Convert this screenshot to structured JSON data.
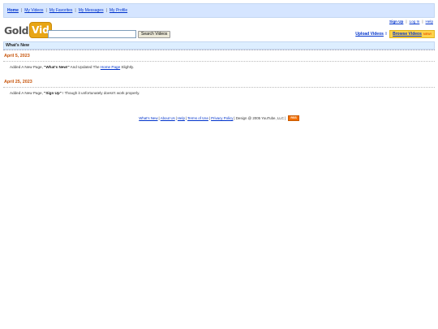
{
  "topnav": {
    "items": [
      {
        "label": "Home"
      },
      {
        "label": "My Videos"
      },
      {
        "label": "My Favorites"
      },
      {
        "label": "My Messages"
      },
      {
        "label": "My Profile"
      }
    ],
    "separator": "|"
  },
  "userlinks": {
    "sign_up": "Sign Up",
    "log_in": "Log In",
    "help": "Help",
    "separator": "|"
  },
  "logo": {
    "part1": "Gold",
    "part2": "Vid"
  },
  "search": {
    "value": "",
    "button_label": "Search Videos"
  },
  "actions": {
    "upload_label": "Upload Videos",
    "upload_icon": "arrow-up",
    "browse_label": "Browse Videos",
    "browse_badge": "NEW!"
  },
  "section": {
    "title": "What's New"
  },
  "entries": [
    {
      "date": "April 5, 2023",
      "prefix": "Added A New Page, ",
      "page_name": "\"What's New!\"",
      "middle": " And Updated The ",
      "link": "Home Page",
      "suffix": " Slightly."
    },
    {
      "date": "April 25, 2023",
      "prefix": "Added A New Page, ",
      "page_name": "\"Sign Up\"",
      "suffix": " ! Though it unfortunately doesn't work properly."
    }
  ],
  "footer": {
    "links": [
      "What's New",
      "About Us",
      "Help",
      "Terms of Use",
      "Privacy Policy"
    ],
    "copyright": "| Design @ 2005 YouTube, LLC |",
    "rss_label": "RSS"
  },
  "colors": {
    "nav_bg": "#d5e5ff",
    "section_bg": "#ddeeff",
    "link": "#0033cc",
    "date": "#c7540a",
    "logo_accent": "#e8a514",
    "browse_bg": "#fed34c",
    "rss_bg": "#f46e00"
  }
}
